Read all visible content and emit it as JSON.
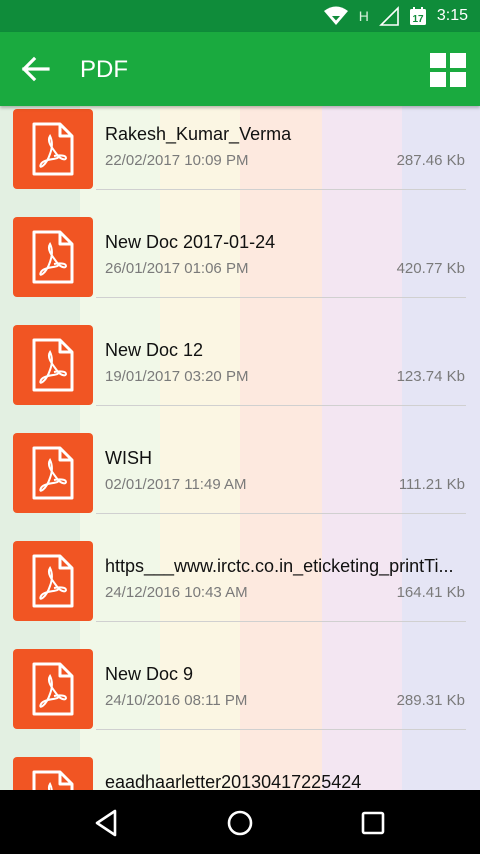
{
  "status_bar": {
    "time": "3:15",
    "network_label": "H",
    "icons": [
      "wifi-icon",
      "signal-icon",
      "calendar-icon"
    ]
  },
  "app_bar": {
    "title": "PDF",
    "back_icon": "arrow-left-icon",
    "grid_icon": "grid-view-icon",
    "accent": "#1aaa3f"
  },
  "files": [
    {
      "name": "Rakesh_Kumar_Verma",
      "date": "22/02/2017 10:09 PM",
      "size": "287.46 Kb"
    },
    {
      "name": "New Doc 2017-01-24",
      "date": "26/01/2017 01:06 PM",
      "size": "420.77 Kb"
    },
    {
      "name": "New Doc 12",
      "date": "19/01/2017 03:20 PM",
      "size": "123.74 Kb"
    },
    {
      "name": "WISH",
      "date": "02/01/2017 11:49 AM",
      "size": "111.21 Kb"
    },
    {
      "name": "https___www.irctc.co.in_eticketing_printTi...",
      "date": "24/12/2016 10:43 AM",
      "size": "164.41 Kb"
    },
    {
      "name": "New Doc 9",
      "date": "24/10/2016 08:11 PM",
      "size": "289.31 Kb"
    },
    {
      "name": "eaadhaarletter20130417225424",
      "date": "",
      "size": ""
    }
  ],
  "file_icon": {
    "name": "pdf-file-icon",
    "color": "#f15523"
  },
  "nav_bar": {
    "icons": [
      "back-triangle-icon",
      "home-circle-icon",
      "recents-square-icon"
    ]
  }
}
